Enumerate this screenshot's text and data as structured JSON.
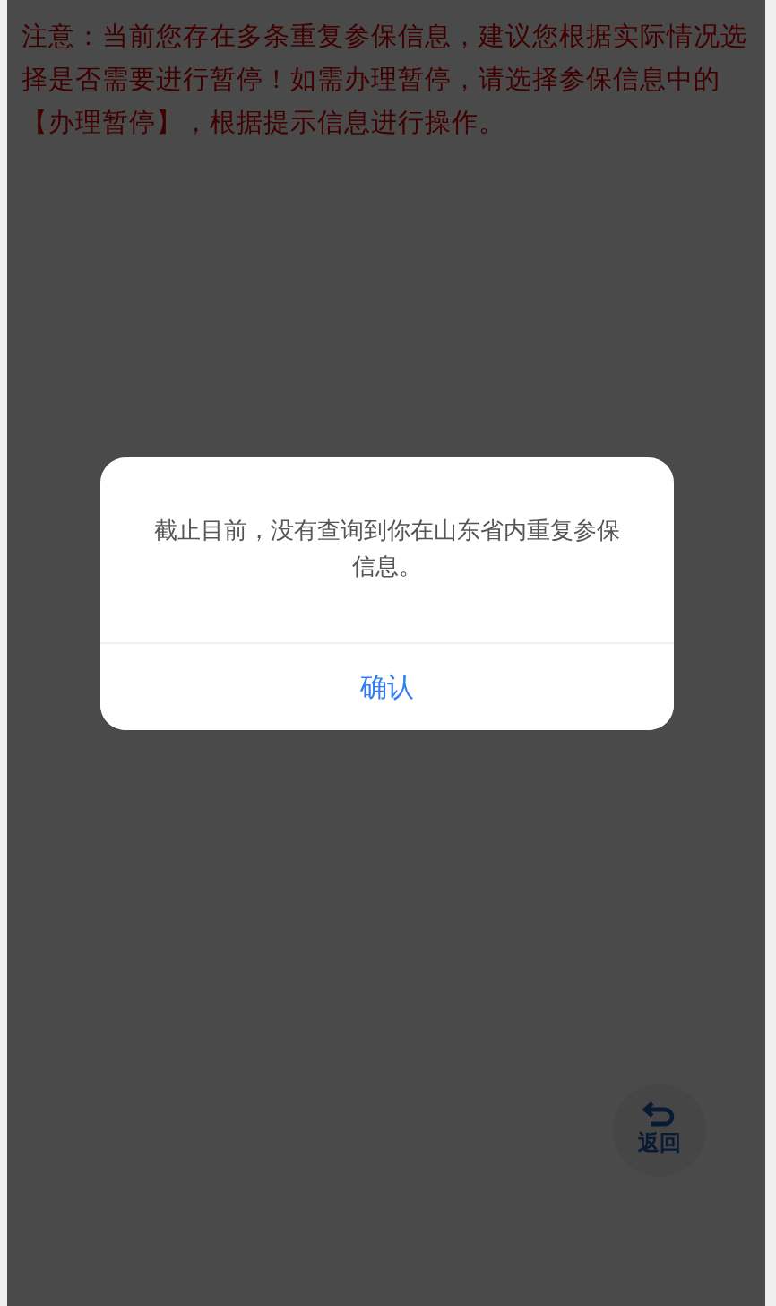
{
  "notice": "注意：当前您存在多条重复参保信息，建议您根据实际情况选择是否需要进行暂停！如需办理暂停，请选择参保信息中的【办理暂停】，根据提示信息进行操作。",
  "back_button": {
    "label": "返回"
  },
  "dialog": {
    "message": "截止目前，没有查询到你在山东省内重复参保信息。",
    "buttons": [
      "确认"
    ]
  }
}
